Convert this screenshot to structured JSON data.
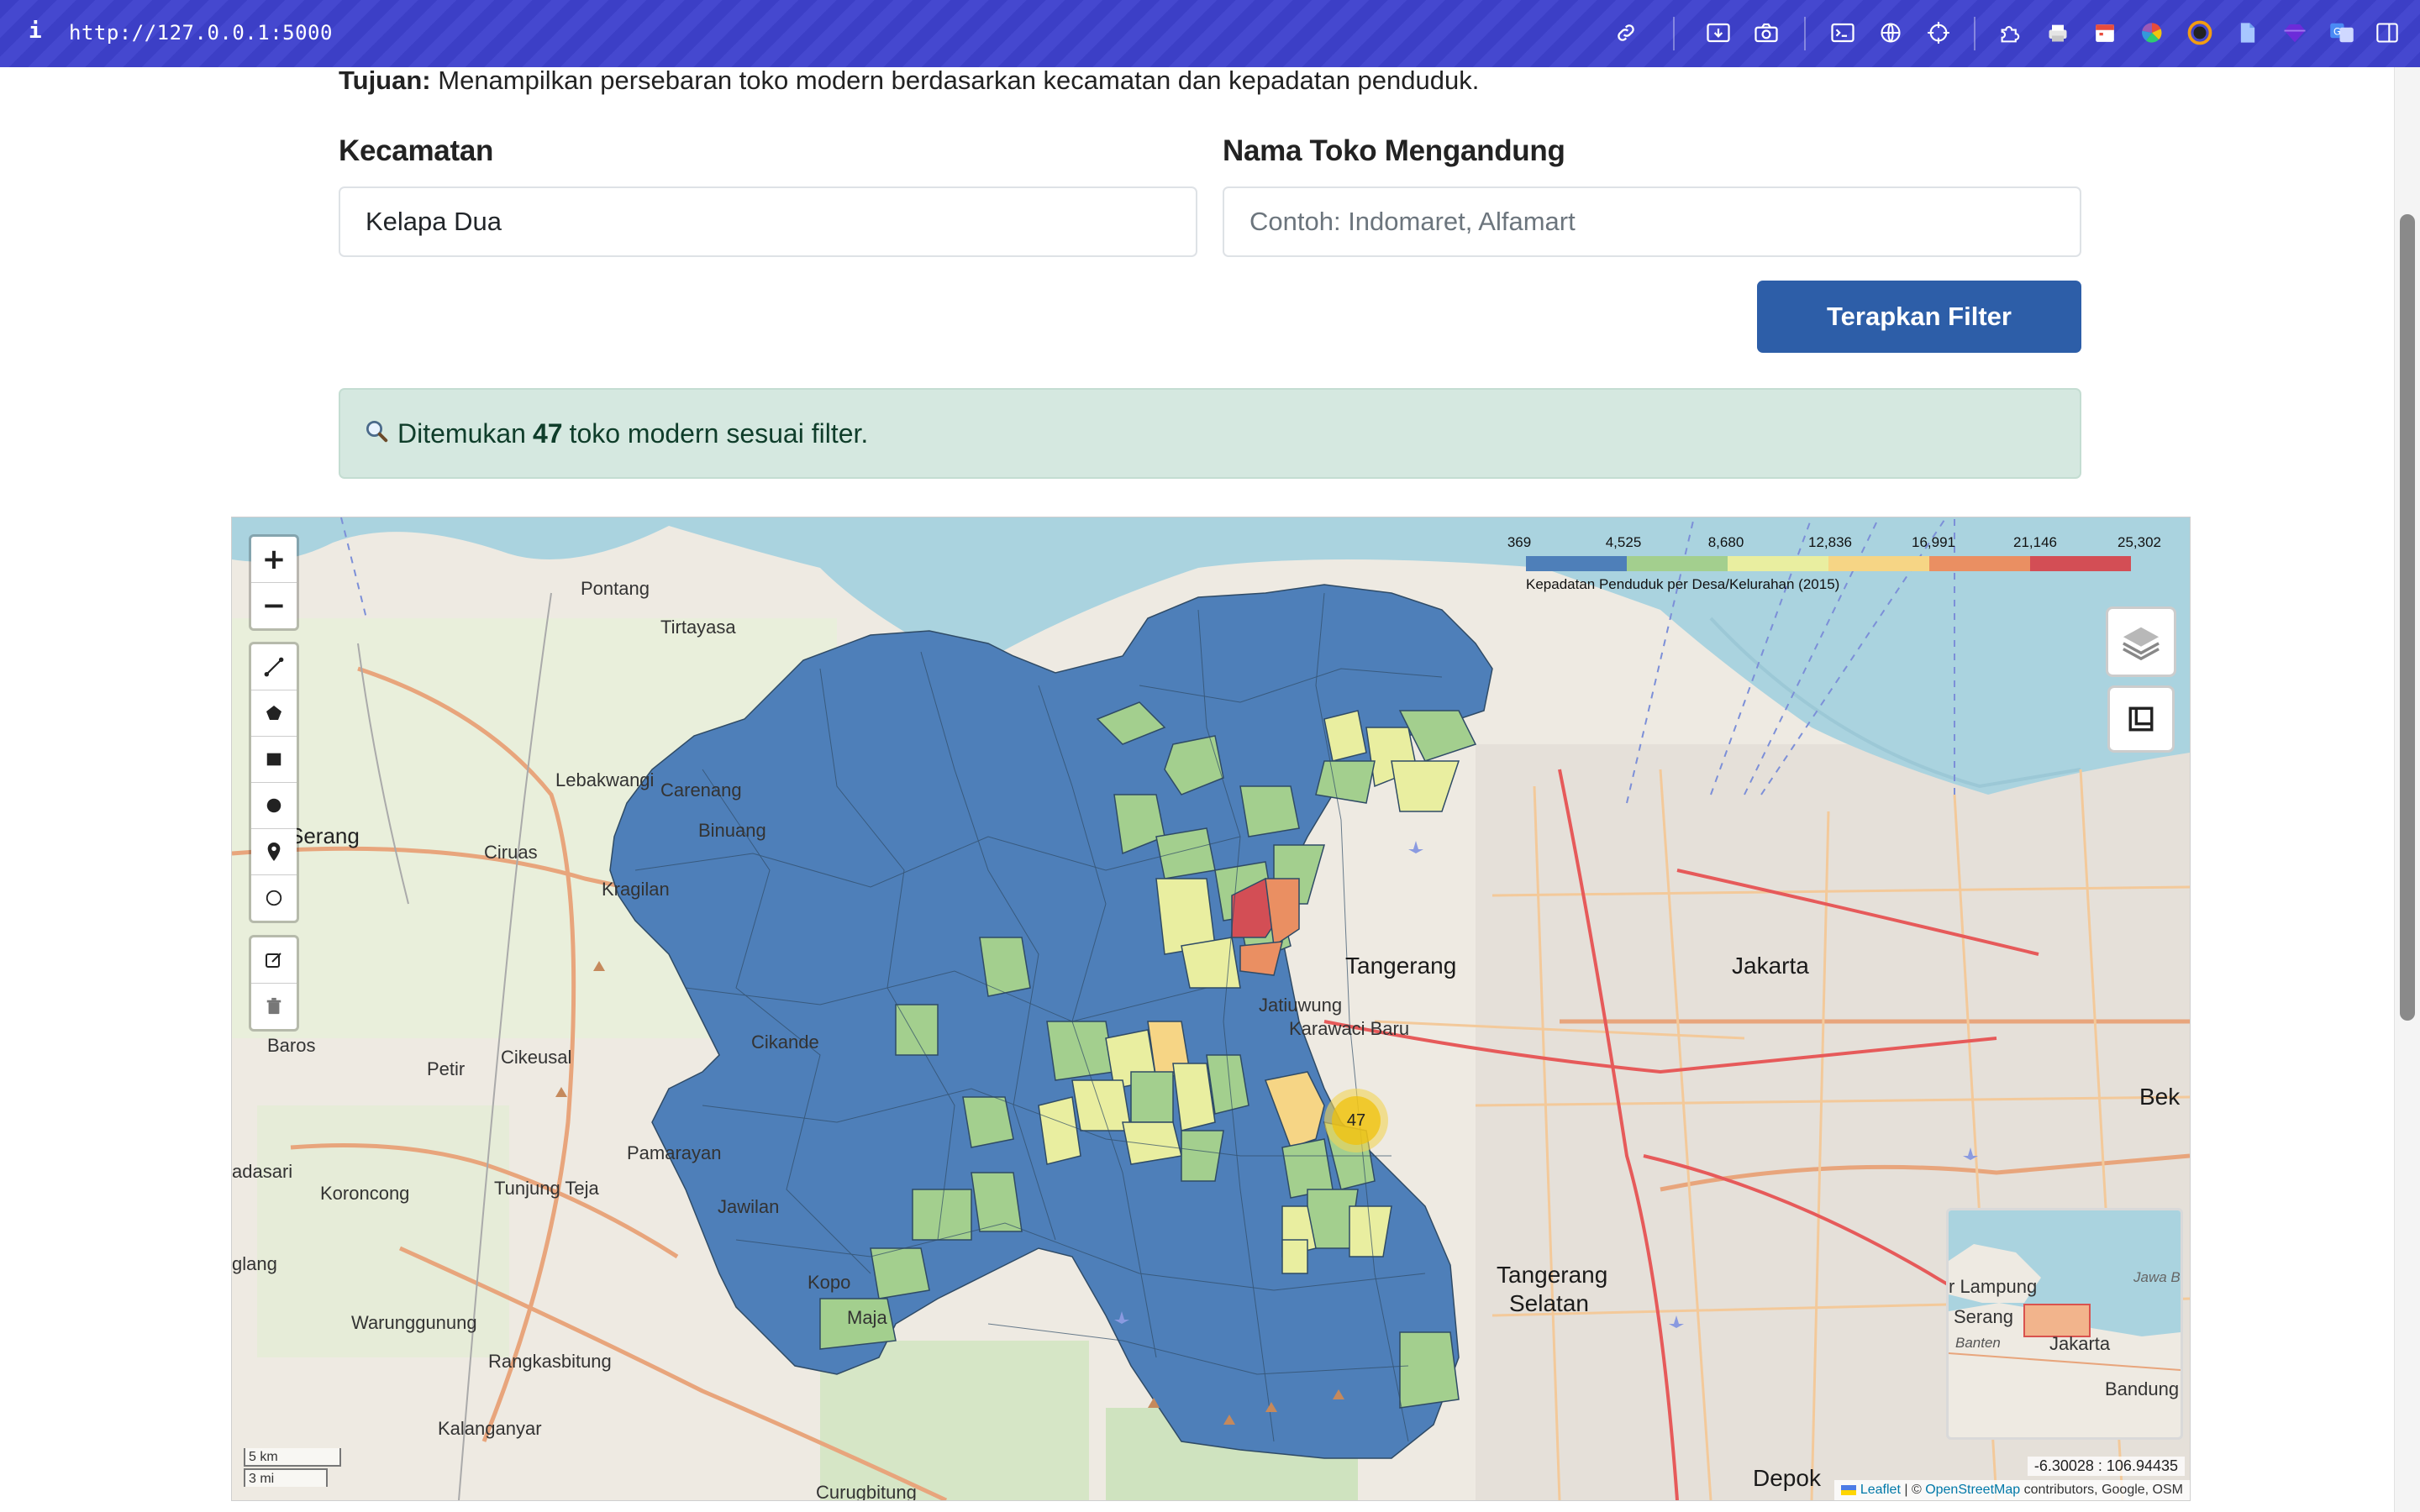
{
  "browser": {
    "url": "http://127.0.0.1:5000",
    "info_glyph": "i"
  },
  "page": {
    "purpose_label": "Tujuan:",
    "purpose_text": "Menampilkan persebaran toko modern berdasarkan kecamatan dan kepadatan penduduk."
  },
  "filters": {
    "kecamatan_label": "Kecamatan",
    "kecamatan_value": "Kelapa Dua",
    "nama_toko_label": "Nama Toko Mengandung",
    "nama_toko_placeholder": "Contoh: Indomaret, Alfamart",
    "apply_label": "Terapkan Filter"
  },
  "result": {
    "prefix": "Ditemukan",
    "count": "47",
    "suffix": "toko modern sesuai filter."
  },
  "map": {
    "zoom_in": "+",
    "zoom_out": "−",
    "legend": {
      "ticks": [
        "369",
        "4,525",
        "8,680",
        "12,836",
        "16,991",
        "21,146",
        "25,302"
      ],
      "colors": [
        "#4e7fb9",
        "#a3cf8e",
        "#e9eea0",
        "#f6d585",
        "#ea8f62",
        "#d34e55"
      ],
      "title": "Kepadatan Penduduk per Desa/Kelurahan (2015)"
    },
    "cluster_count": "47",
    "place_labels": {
      "pontang": "Pontang",
      "tirtayasa": "Tirtayasa",
      "lebakwangi": "Lebakwangi",
      "carenang": "Carenang",
      "binuang": "Binuang",
      "serang": "Serang",
      "ciruas": "Ciruas",
      "kragilan": "Kragilan",
      "baros": "Baros",
      "petir": "Petir",
      "cikeusal": "Cikeusal",
      "cikande": "Cikande",
      "pamarayan": "Pamarayan",
      "cadasari": "adasari",
      "koroncong": "Koroncong",
      "tunjung_teja": "Tunjung Teja",
      "jawilan": "Jawilan",
      "kopo": "Kopo",
      "maja": "Maja",
      "glang": "glang",
      "warunggunung": "Warunggunung",
      "rangkasbitung": "Rangkasbitung",
      "kalanganyar": "Kalanganyar",
      "curugbitung": "Curugbitung",
      "tangerang": "Tangerang",
      "jatiuwung": "Jatiuwung",
      "karawaci": "Karawaci Baru",
      "jakarta": "Jakarta",
      "tangsel_1": "Tangerang",
      "tangsel_2": "Selatan",
      "bekasi": "Bek",
      "depok": "Depok"
    },
    "minimap_labels": {
      "lampung": "r Lampung",
      "jawa": "Jawa Ba",
      "serang": "Serang",
      "banten": "Banten",
      "jakarta": "Jakarta",
      "bandung": "Bandung"
    },
    "scale_km": "5 km",
    "scale_mi": "3 mi",
    "coordinates": "-6.30028 : 106.94435",
    "attribution": {
      "leaflet": "Leaflet",
      "sep": " | © ",
      "osm": "OpenStreetMap",
      "rest": " contributors, Google, OSM"
    }
  }
}
